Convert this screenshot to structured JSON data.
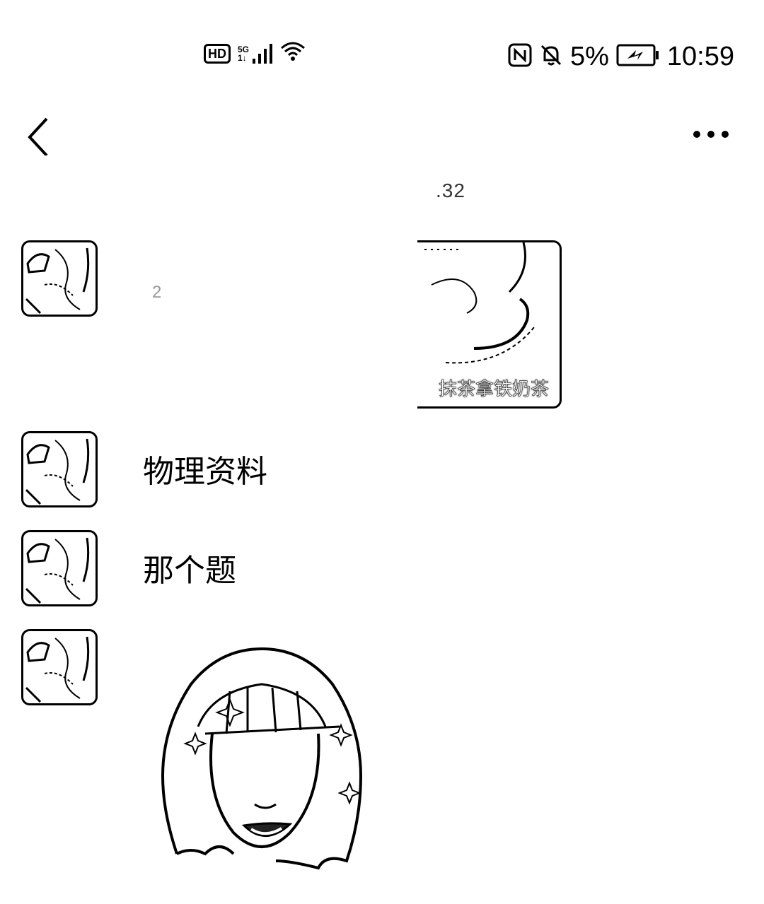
{
  "status_bar": {
    "hd_label": "HD",
    "network_label": "5G",
    "battery_percent": "5%",
    "time": "10:59",
    "icons": [
      "hd-icon",
      "signal-icon",
      "wifi-icon",
      "nfc-icon",
      "bell-muted-icon",
      "battery-charging-icon"
    ]
  },
  "nav": {
    "back_icon": "chevron-left-icon",
    "more_icon": "more-dots-icon"
  },
  "chat": {
    "timestamp": ".32",
    "messages": [
      {
        "type": "image",
        "caption": "抹茶拿铁奶茶",
        "faint_text": "2"
      },
      {
        "type": "text",
        "text": "物理资料"
      },
      {
        "type": "text",
        "text": "那个题"
      },
      {
        "type": "sticker",
        "sticker_name": "girl-smiling-sticker"
      }
    ]
  }
}
